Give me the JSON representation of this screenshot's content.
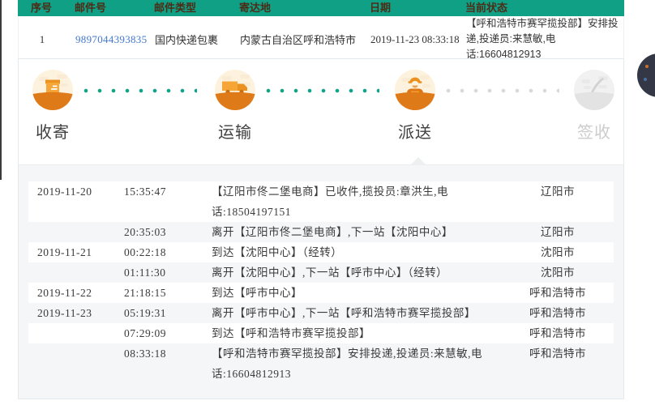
{
  "colors": {
    "accent_green": "#0fa085",
    "step_orange": "#df7a18",
    "link_blue": "#4378cf",
    "stripe_gray": "#f5f6f7"
  },
  "shipment_table": {
    "headers": [
      "序号",
      "邮件号",
      "邮件类型",
      "寄达地",
      "日期",
      "当前状态"
    ],
    "row": {
      "index": "1",
      "mail_no": "9897044393835",
      "mail_type": "国内快递包裹",
      "destination": "内蒙古自治区呼和浩特市",
      "date": "2019-11-23 08:33:18",
      "status": "【呼和浩特市赛罕揽投部】安排投递,投递员:来慧敏,电话:16604812913"
    }
  },
  "progress": {
    "steps": [
      {
        "label": "收寄",
        "icon": "parcel-icon",
        "state": "done"
      },
      {
        "label": "运输",
        "icon": "truck-icon",
        "state": "done"
      },
      {
        "label": "派送",
        "icon": "courier-icon",
        "state": "active"
      },
      {
        "label": "签收",
        "icon": "signature-icon",
        "state": "pending"
      }
    ]
  },
  "timeline": {
    "events": [
      {
        "date": "2019-11-20",
        "time": "15:35:47",
        "desc": "【辽阳市佟二堡电商】已收件,揽投员:章洪生,电话:18504197151",
        "location": "辽阳市"
      },
      {
        "date": "",
        "time": "20:35:03",
        "desc": "离开【辽阳市佟二堡电商】,下一站【沈阳中心】",
        "location": "辽阳市"
      },
      {
        "date": "2019-11-21",
        "time": "00:22:18",
        "desc": "到达【沈阳中心】（经转）",
        "location": "沈阳市"
      },
      {
        "date": "",
        "time": "01:11:30",
        "desc": "离开【沈阳中心】,下一站【呼市中心】（经转）",
        "location": "沈阳市"
      },
      {
        "date": "2019-11-22",
        "time": "21:18:15",
        "desc": "到达【呼市中心】",
        "location": "呼和浩特市"
      },
      {
        "date": "2019-11-23",
        "time": "05:19:31",
        "desc": "离开【呼市中心】,下一站【呼和浩特市赛罕揽投部】",
        "location": "呼和浩特市"
      },
      {
        "date": "",
        "time": "07:29:09",
        "desc": "到达【呼和浩特市赛罕揽投部】",
        "location": "呼和浩特市"
      },
      {
        "date": "",
        "time": "08:33:18",
        "desc": "【呼和浩特市赛罕揽投部】安排投递,投递员:来慧敏,电话:16604812913",
        "location": "呼和浩特市"
      }
    ]
  }
}
